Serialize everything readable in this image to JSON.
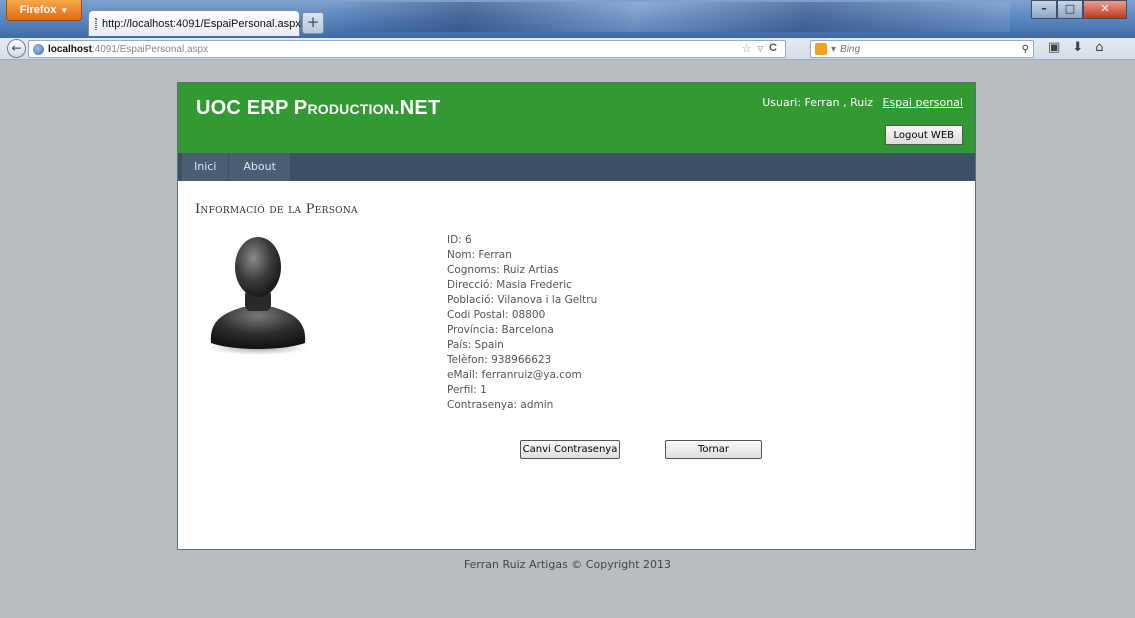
{
  "browser": {
    "menu_button": "Firefox",
    "tab_title": "http://localhost:4091/EspaiPersonal.aspx",
    "new_tab": "+",
    "url_host": "localhost",
    "url_path": ":4091/EspaiPersonal.aspx",
    "search_placeholder": "Bing"
  },
  "header": {
    "title": "UOC ERP Production.NET",
    "user_text": "Usuari: Ferran , Ruiz",
    "personal_link": "Espai personal",
    "logout_label": "Logout WEB"
  },
  "menu": {
    "items": [
      "Inici",
      "About"
    ]
  },
  "main": {
    "section_title": "Informació de la Persona",
    "info": [
      "ID: 6",
      "Nom: Ferran",
      "Cognoms: Ruiz Artias",
      "Direcció: Masia Frederic",
      "Població: Vilanova i la Geltru",
      "Codi Postal: 08800",
      "Província: Barcelona",
      "País: Spain",
      "Telèfon: 938966623",
      "eMail: ferranruiz@ya.com",
      "Perfil: 1",
      "Contrasenya: admin"
    ],
    "change_password_label": "Canvi Contrasenya",
    "back_label": "Tornar"
  },
  "footer": {
    "text": "Ferran Ruiz Artigas © Copyright 2013"
  },
  "colors": {
    "header_green": "#339933",
    "menu_dark": "#3d4f62",
    "page_background": "#b9bcc1"
  }
}
